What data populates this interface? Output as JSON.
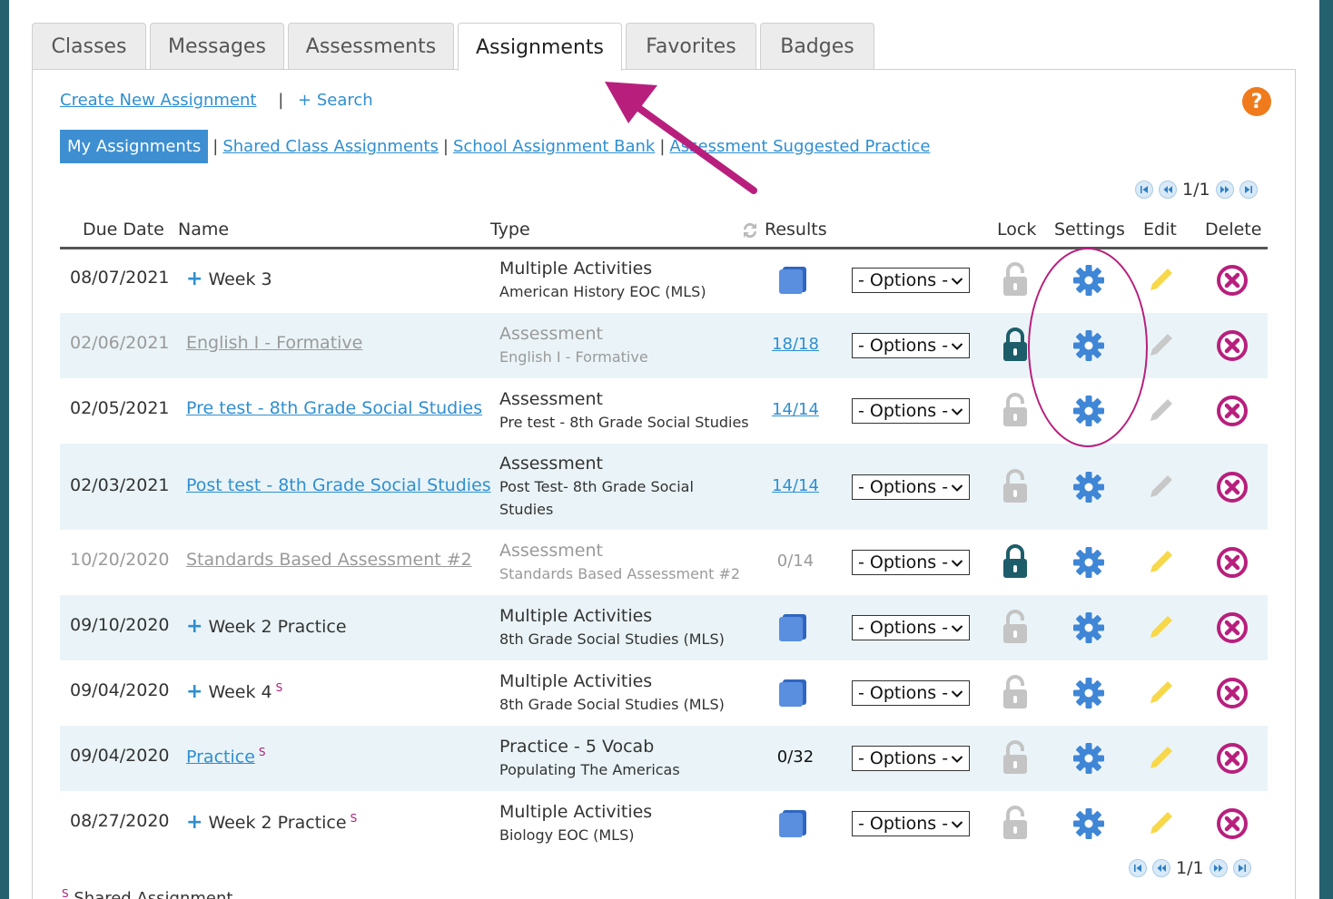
{
  "tabs": [
    "Classes",
    "Messages",
    "Assessments",
    "Assignments",
    "Favorites",
    "Badges"
  ],
  "active_tab": "Assignments",
  "actions": {
    "create_label": "Create New Assignment",
    "separator": "|",
    "search_label": "+ Search"
  },
  "help_label": "?",
  "subnav": {
    "active": "My Assignments",
    "items": [
      "Shared Class Assignments",
      "School Assignment Bank",
      "Assessment Suggested Practice"
    ]
  },
  "pager": {
    "page": "1/1"
  },
  "columns": {
    "due_date": "Due Date",
    "name": "Name",
    "type": "Type",
    "results": "Results",
    "lock": "Lock",
    "settings": "Settings",
    "edit": "Edit",
    "delete": "Delete"
  },
  "options_label": "- Options -",
  "rows": [
    {
      "date": "08/07/2021",
      "name": "Week 3",
      "type": "Multiple Activities",
      "subtype": "American History EOC (MLS)",
      "result": "",
      "locked": false,
      "editable": true,
      "muted": false
    },
    {
      "date": "02/06/2021",
      "name": "English I - Formative",
      "type": "Assessment",
      "subtype": "English I - Formative",
      "result": "18/18",
      "locked": true,
      "editable": false,
      "muted": true
    },
    {
      "date": "02/05/2021",
      "name": "Pre test - 8th Grade Social Studies",
      "type": "Assessment",
      "subtype": "Pre test - 8th Grade Social Studies",
      "result": "14/14",
      "locked": false,
      "editable": false,
      "muted": false
    },
    {
      "date": "02/03/2021",
      "name": "Post test - 8th Grade Social Studies",
      "type": "Assessment",
      "subtype": "Post Test- 8th Grade Social Studies",
      "result": "14/14",
      "locked": false,
      "editable": false,
      "muted": false
    },
    {
      "date": "10/20/2020",
      "name": "Standards Based Assessment #2",
      "type": "Assessment",
      "subtype": "Standards Based Assessment #2",
      "result": "0/14",
      "locked": true,
      "editable": true,
      "muted": true
    },
    {
      "date": "09/10/2020",
      "name": "Week 2 Practice",
      "type": "Multiple Activities",
      "subtype": "8th Grade Social Studies (MLS)",
      "result": "",
      "locked": false,
      "editable": true,
      "muted": false
    },
    {
      "date": "09/04/2020",
      "name": "Week 4",
      "shared_mark": "S",
      "type": "Multiple Activities",
      "subtype": "8th Grade Social Studies (MLS)",
      "result": "",
      "locked": false,
      "editable": true,
      "muted": false
    },
    {
      "date": "09/04/2020",
      "name": "Practice",
      "shared_mark": "S",
      "type": "Practice - 5 Vocab",
      "subtype": "Populating The Americas",
      "result": "0/32",
      "locked": false,
      "editable": true,
      "muted": false
    },
    {
      "date": "08/27/2020",
      "name": "Week 2 Practice",
      "shared_mark": "S",
      "type": "Multiple Activities",
      "subtype": "Biology EOC (MLS)",
      "result": "",
      "locked": false,
      "editable": true,
      "muted": false
    }
  ],
  "footnote": {
    "mark": "S",
    "text": "Shared Assignment"
  },
  "colors": {
    "link": "#2f8fd0",
    "accent_magenta": "#b81f7d",
    "gear_blue": "#3f86d6",
    "lock_teal": "#1d5d69",
    "pencil_yellow": "#f7d84a"
  }
}
